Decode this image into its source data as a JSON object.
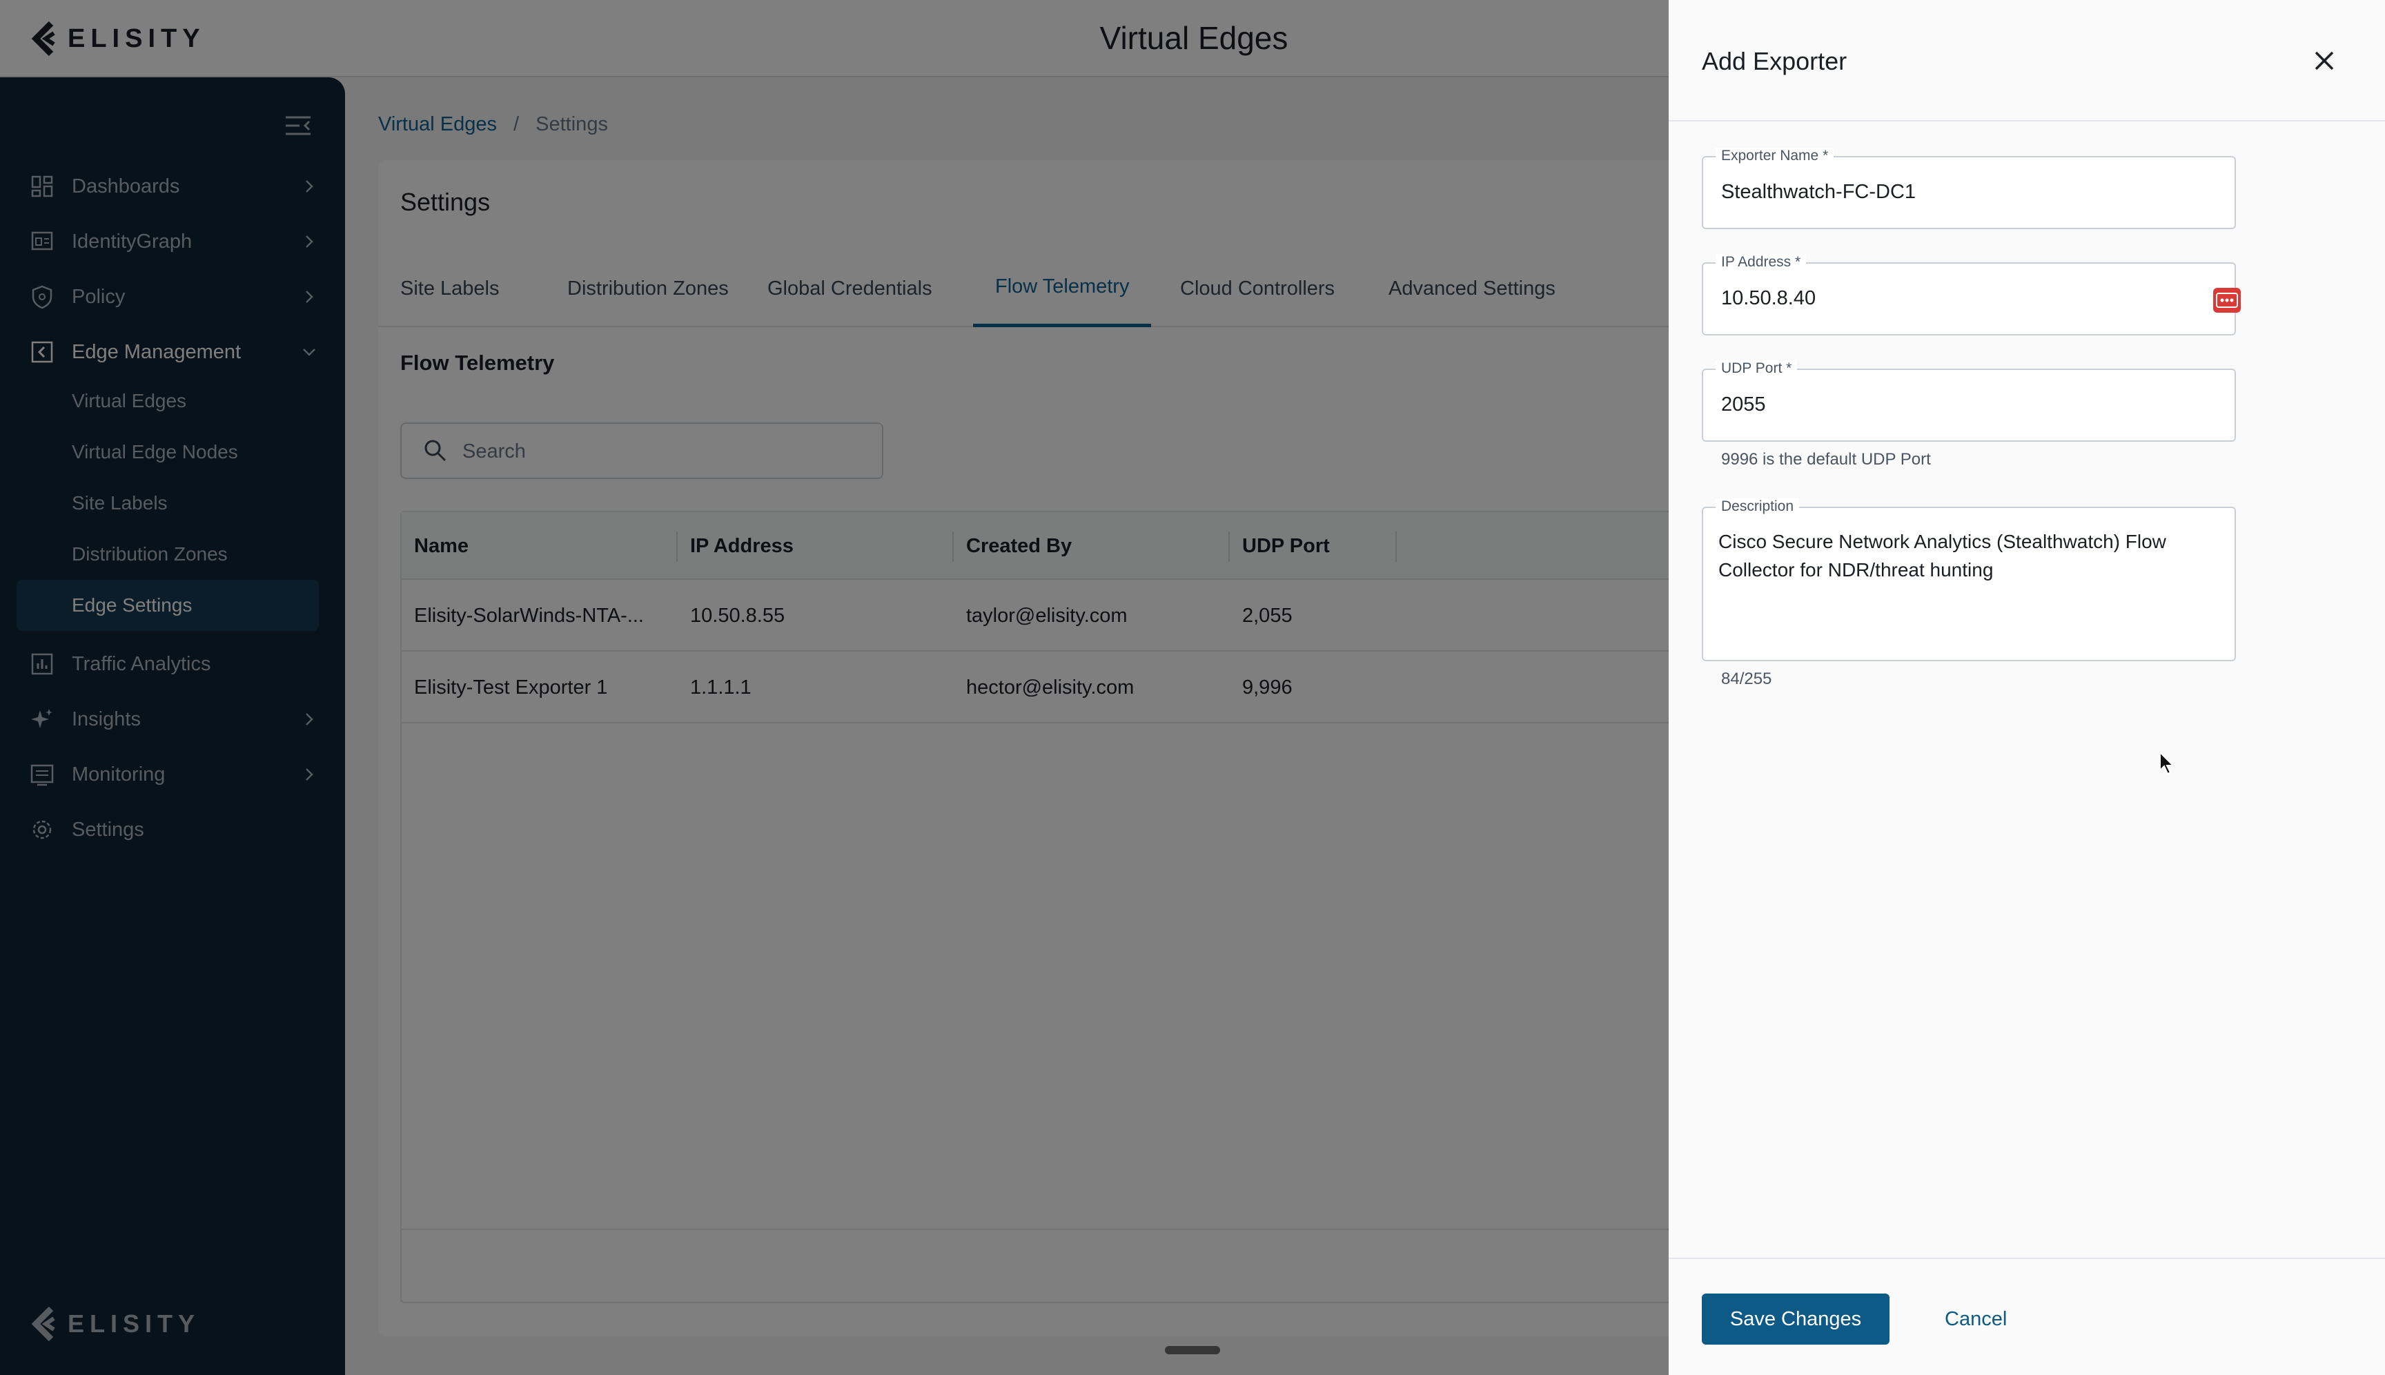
{
  "app": {
    "brand": "ELISITY",
    "page_title": "Virtual Edges"
  },
  "sidebar": {
    "items": [
      {
        "label": "Dashboards",
        "icon": "dashboard-icon",
        "chevron": "right"
      },
      {
        "label": "IdentityGraph",
        "icon": "identity-graph-icon",
        "chevron": "right"
      },
      {
        "label": "Policy",
        "icon": "shield-icon",
        "chevron": "right"
      },
      {
        "label": "Edge Management",
        "icon": "edge-management-icon",
        "chevron": "down"
      },
      {
        "label": "Traffic Analytics",
        "icon": "bar-chart-icon",
        "chevron": ""
      },
      {
        "label": "Insights",
        "icon": "sparkle-icon",
        "chevron": "right"
      },
      {
        "label": "Monitoring",
        "icon": "monitor-icon",
        "chevron": "right"
      },
      {
        "label": "Settings",
        "icon": "gear-icon",
        "chevron": ""
      }
    ],
    "edge_management_subitems": [
      {
        "label": "Virtual Edges"
      },
      {
        "label": "Virtual Edge Nodes"
      },
      {
        "label": "Site Labels"
      },
      {
        "label": "Distribution Zones"
      },
      {
        "label": "Edge Settings",
        "selected": true
      }
    ],
    "footer_brand": "ELISITY"
  },
  "breadcrumb": {
    "link": "Virtual Edges",
    "separator": "/",
    "current": "Settings"
  },
  "settings": {
    "title": "Settings",
    "tabs": [
      {
        "label": "Site Labels"
      },
      {
        "label": "Distribution Zones"
      },
      {
        "label": "Global Credentials"
      },
      {
        "label": "Flow Telemetry",
        "active": true
      },
      {
        "label": "Cloud Controllers"
      },
      {
        "label": "Advanced Settings"
      }
    ],
    "section_title": "Flow Telemetry",
    "search": {
      "placeholder": "Search",
      "value": ""
    },
    "table": {
      "columns": [
        "Name",
        "IP Address",
        "Created By",
        "UDP Port"
      ],
      "rows": [
        [
          "Elisity-SolarWinds-NTA-...",
          "10.50.8.55",
          "taylor@elisity.com",
          "2,055"
        ],
        [
          "Elisity-Test Exporter 1",
          "1.1.1.1",
          "hector@elisity.com",
          "9,996"
        ]
      ]
    }
  },
  "drawer": {
    "title": "Add Exporter",
    "fields": {
      "exporter_name": {
        "label": "Exporter Name",
        "required": "*",
        "value": "Stealthwatch-FC-DC1"
      },
      "ip_address": {
        "label": "IP Address",
        "required": "*",
        "value": "10.50.8.40"
      },
      "udp_port": {
        "label": "UDP Port",
        "required": "*",
        "value": "2055",
        "helper": "9996 is the default UDP Port"
      },
      "description": {
        "label": "Description",
        "value": "Cisco Secure Network Analytics (Stealthwatch) Flow Collector for NDR/threat hunting",
        "counter": "84/255"
      }
    },
    "save_label": "Save Changes",
    "cancel_label": "Cancel"
  },
  "colors": {
    "sidebar_bg": "#0e2535",
    "accent": "#0f6291",
    "primary_button": "#0d5a86",
    "password_icon": "#d93a36"
  }
}
